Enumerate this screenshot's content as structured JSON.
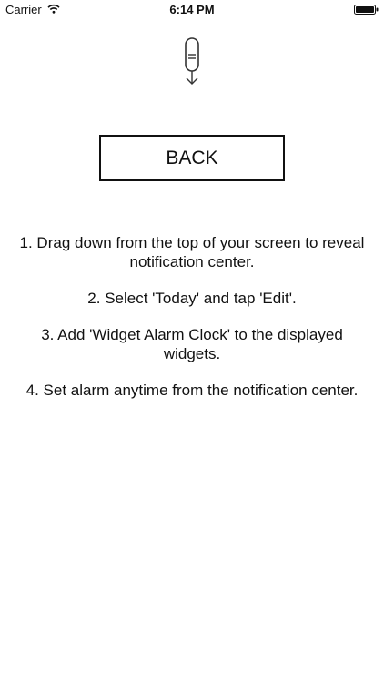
{
  "status_bar": {
    "carrier": "Carrier",
    "time": "6:14 PM"
  },
  "hint_icon": "finger-swipe-down-icon",
  "back_button": {
    "label": "BACK"
  },
  "instructions": [
    "1. Drag down from the top of your screen to reveal notification center.",
    "2. Select 'Today' and tap 'Edit'.",
    "3. Add 'Widget Alarm Clock' to the displayed widgets.",
    "4. Set alarm anytime from the notification center."
  ]
}
